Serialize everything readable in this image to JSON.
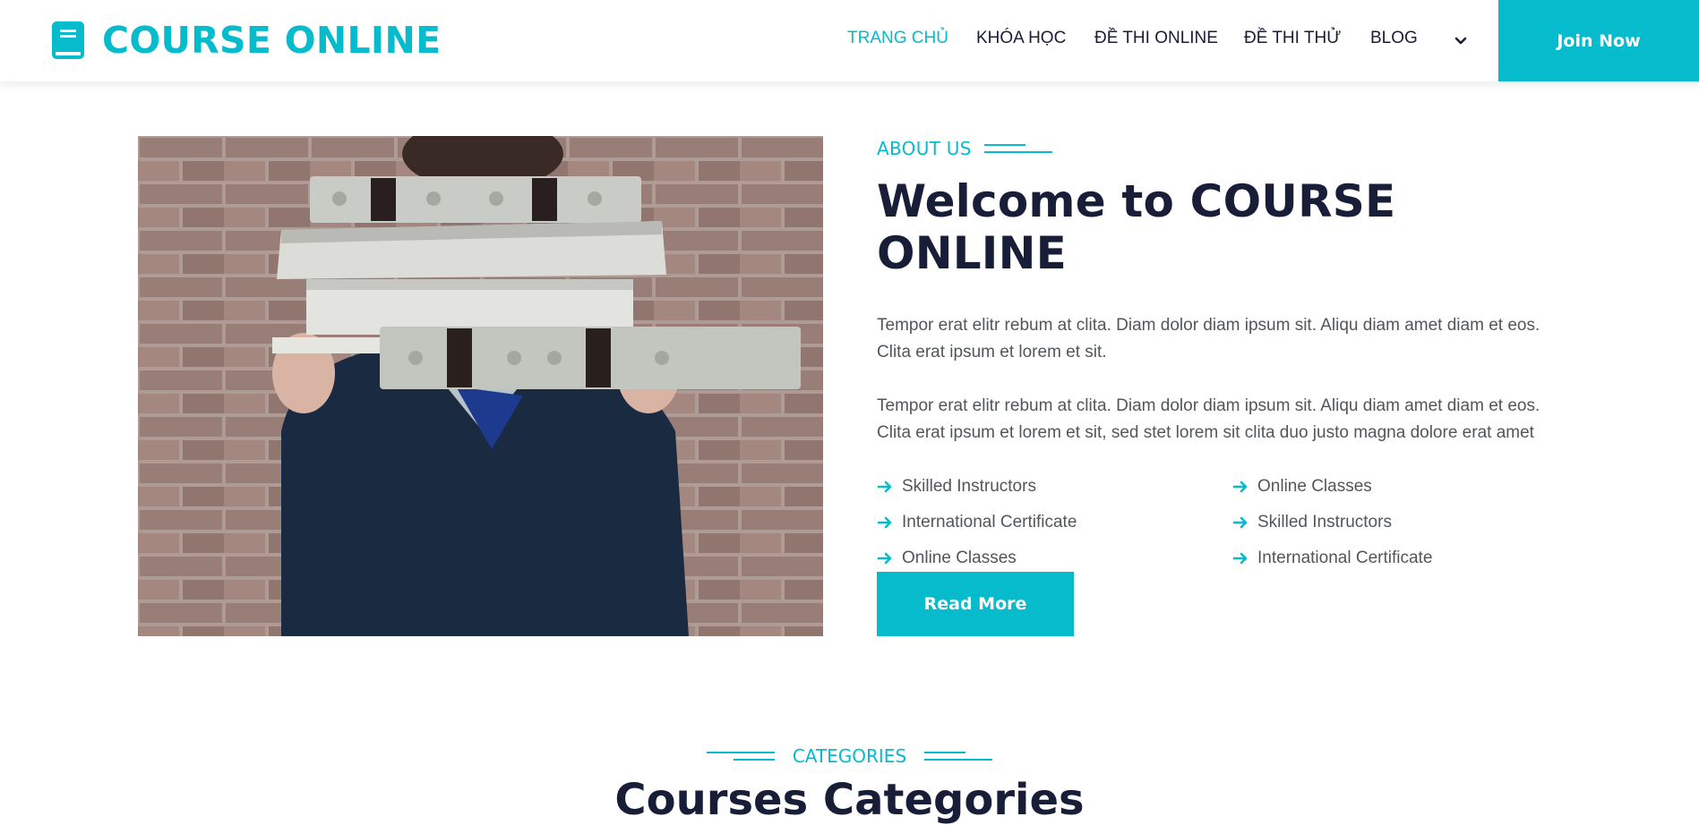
{
  "brand": {
    "name": "COURSE ONLINE",
    "icon": "book-icon",
    "color": "#06BBCC"
  },
  "nav": {
    "items": [
      {
        "label": "TRANG CHỦ",
        "active": true
      },
      {
        "label": "KHÓA HỌC",
        "active": false
      },
      {
        "label": "ĐỀ THI ONLINE",
        "active": false
      },
      {
        "label": "ĐỀ THI THỬ",
        "active": false
      },
      {
        "label": "BLOG",
        "active": false
      }
    ],
    "dropdown_icon": "chevron-down-icon",
    "join_label": "Join Now"
  },
  "about": {
    "subtitle": "ABOUT US",
    "title": "Welcome to COURSE ONLINE",
    "paragraph1": "Tempor erat elitr rebum at clita. Diam dolor diam ipsum sit. Aliqu diam amet diam et eos. Clita erat ipsum et lorem et sit.",
    "paragraph2": "Tempor erat elitr rebum at clita. Diam dolor diam ipsum sit. Aliqu diam amet diam et eos. Clita erat ipsum et lorem et sit, sed stet lorem sit clita duo justo magna dolore erat amet",
    "features": [
      "Skilled Instructors",
      "Online Classes",
      "International Certificate",
      "Skilled Instructors",
      "Online Classes",
      "International Certificate"
    ],
    "feature_icon": "arrow-right-icon",
    "read_more_label": "Read More"
  },
  "categories": {
    "subtitle": "CATEGORIES",
    "title": "Courses Categories"
  },
  "colors": {
    "primary": "#06BBCC",
    "dark": "#181d38",
    "text": "#52565b"
  }
}
